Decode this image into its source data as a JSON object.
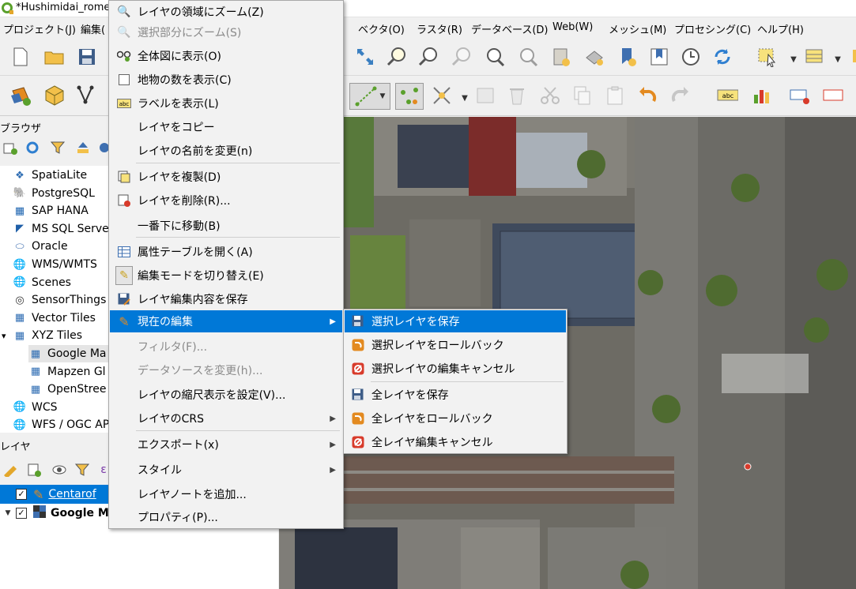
{
  "window": {
    "title": "*Hushimidai_rome"
  },
  "menubar": [
    "プロジェクト(J)",
    "編集(",
    "ベクタ(O)",
    "ラスタ(R)",
    "データベース(D)",
    "Web(W)",
    "メッシュ(M)",
    "プロセシング(C)",
    "ヘルプ(H)"
  ],
  "panels": {
    "browser_title": "ブラウザ",
    "layers_title": "レイヤ"
  },
  "browser_items": [
    {
      "label": "SpatiaLite",
      "icon": "spatialite-icon"
    },
    {
      "label": "PostgreSQL",
      "icon": "postgresql-icon"
    },
    {
      "label": "SAP HANA",
      "icon": "sap-hana-icon"
    },
    {
      "label": "MS SQL Serve",
      "icon": "mssql-icon"
    },
    {
      "label": "Oracle",
      "icon": "oracle-icon"
    },
    {
      "label": "WMS/WMTS",
      "icon": "globe-icon"
    },
    {
      "label": "Scenes",
      "icon": "globe-icon"
    },
    {
      "label": "SensorThings",
      "icon": "sensor-icon"
    },
    {
      "label": "Vector Tiles",
      "icon": "grid-icon"
    },
    {
      "label": "XYZ Tiles",
      "icon": "grid-icon"
    },
    {
      "label": "Google Ma",
      "icon": "grid-icon"
    },
    {
      "label": "Mapzen Gl",
      "icon": "grid-icon"
    },
    {
      "label": "OpenStree",
      "icon": "grid-icon"
    },
    {
      "label": "WCS",
      "icon": "globe-icon"
    },
    {
      "label": "WFS / OGC AP",
      "icon": "globe-icon"
    }
  ],
  "layers": [
    {
      "label": "Centarof",
      "checked": "✓",
      "icon": "pencil-icon"
    },
    {
      "label": "Google M",
      "checked": "✓",
      "icon": "raster-icon"
    }
  ],
  "context_menu": {
    "items": [
      {
        "label": "レイヤの領域にズーム(Z)",
        "icon": "zoom-layer-icon",
        "disabled": false
      },
      {
        "label": "選択部分にズーム(S)",
        "icon": "zoom-selection-icon",
        "disabled": true
      },
      {
        "label": "全体図に表示(O)",
        "icon": "overview-icon",
        "disabled": false
      },
      {
        "label": "地物の数を表示(C)",
        "icon": "checkbox-icon",
        "disabled": false
      },
      {
        "label": "ラベルを表示(L)",
        "icon": "label-icon",
        "disabled": false
      },
      {
        "label": "レイヤをコピー",
        "icon": "",
        "disabled": false
      },
      {
        "label": "レイヤの名前を変更(n)",
        "icon": "",
        "disabled": false
      },
      {
        "label": "レイヤを複製(D)",
        "icon": "duplicate-icon",
        "disabled": false
      },
      {
        "label": "レイヤを削除(R)...",
        "icon": "remove-icon",
        "disabled": false
      },
      {
        "label": "一番下に移動(B)",
        "icon": "",
        "disabled": false
      },
      {
        "label": "属性テーブルを開く(A)",
        "icon": "table-icon",
        "disabled": false
      },
      {
        "label": "編集モードを切り替え(E)",
        "icon": "pencil-icon",
        "disabled": false
      },
      {
        "label": "レイヤ編集内容を保存",
        "icon": "save-edits-icon",
        "disabled": false
      },
      {
        "label": "現在の編集",
        "icon": "current-edits-icon",
        "disabled": false,
        "highlighted": true,
        "submenu": true
      },
      {
        "label": "フィルタ(F)...",
        "icon": "",
        "disabled": true
      },
      {
        "label": "データソースを変更(h)...",
        "icon": "",
        "disabled": true
      },
      {
        "label": "レイヤの縮尺表示を設定(V)...",
        "icon": "",
        "disabled": false
      },
      {
        "label": "レイヤのCRS",
        "icon": "",
        "disabled": false,
        "submenu": true
      },
      {
        "label": "エクスポート(x)",
        "icon": "",
        "disabled": false,
        "submenu": true
      },
      {
        "label": "スタイル",
        "icon": "",
        "disabled": false,
        "submenu": true
      },
      {
        "label": "レイヤノートを追加...",
        "icon": "",
        "disabled": false
      },
      {
        "label": "プロパティ(P)...",
        "icon": "",
        "disabled": false
      }
    ]
  },
  "submenu": {
    "items": [
      {
        "label": "選択レイヤを保存",
        "icon": "save-layer-icon"
      },
      {
        "label": "選択レイヤをロールバック",
        "icon": "rollback-icon"
      },
      {
        "label": "選択レイヤの編集キャンセル",
        "icon": "cancel-edits-icon"
      },
      {
        "label": "全レイヤを保存",
        "icon": "save-all-icon"
      },
      {
        "label": "全レイヤをロールバック",
        "icon": "rollback-all-icon"
      },
      {
        "label": "全レイヤ編集キャンセル",
        "icon": "cancel-all-icon"
      }
    ]
  },
  "colors": {
    "highlight": "#0078d7",
    "qgis_green": "#5aa02c",
    "qgis_orange": "#e3a72b"
  }
}
